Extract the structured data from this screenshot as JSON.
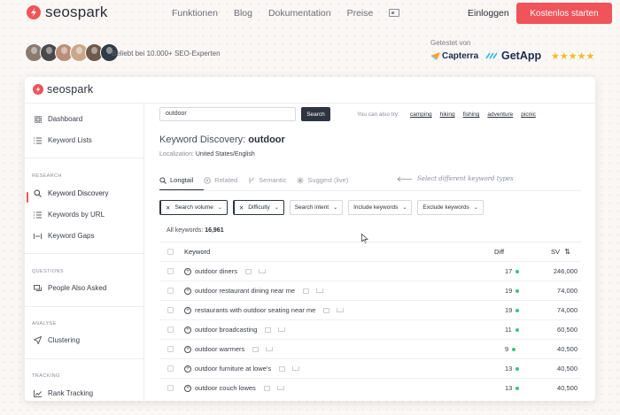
{
  "nav": {
    "brand": "seospark",
    "links": [
      "Funktionen",
      "Blog",
      "Dokumentation",
      "Preise"
    ],
    "login": "Einloggen",
    "cta": "Kostenlos starten"
  },
  "proof": {
    "text": "Beliebt bei 10.000+ SEO-Experten",
    "avatar_colors": [
      "#8b7a6e",
      "#4a4a4a",
      "#b98f7a",
      "#c9a88a",
      "#6e5a4a",
      "#2f3b45"
    ],
    "tested_label": "Getestet von",
    "capterra": "Capterra",
    "getapp": "GetApp",
    "stars": "★★★★★"
  },
  "app": {
    "brand": "seospark",
    "sidebar": {
      "top": [
        {
          "label": "Dashboard",
          "icon": "grid-icon"
        },
        {
          "label": "Keyword Lists",
          "icon": "list-icon"
        }
      ],
      "research_title": "RESEARCH",
      "research": [
        {
          "label": "Keyword Discovery",
          "icon": "search-icon"
        },
        {
          "label": "Keywords by URL",
          "icon": "list-icon"
        },
        {
          "label": "Keyword Gaps",
          "icon": "gap-icon"
        }
      ],
      "questions_title": "QUESTIONS",
      "questions": [
        {
          "label": "People Also Asked",
          "icon": "chat-icon"
        }
      ],
      "analyse_title": "ANALYSE",
      "analyse": [
        {
          "label": "Clustering",
          "icon": "send-icon"
        }
      ],
      "tracking_title": "TRACKING",
      "tracking": [
        {
          "label": "Rank Tracking",
          "icon": "chart-icon"
        }
      ]
    },
    "search": {
      "value": "outdoor",
      "button": "Search",
      "try_label": "You can also try:",
      "suggestions": [
        "camping",
        "hiking",
        "fishing",
        "adventure",
        "picnic"
      ]
    },
    "title_prefix": "Keyword Discovery:",
    "title_term": "outdoor",
    "localization_label": "Localization:",
    "localization_value": "United States/English",
    "tabs": [
      "Longtail",
      "Related",
      "Semantic",
      "Suggest (live)"
    ],
    "hint": "Select different keyword types",
    "filters": {
      "chip1": "Search volume",
      "chip2": "Difficulty",
      "chip3": "Search intent",
      "chip4": "Include keywords",
      "chip5": "Exclude keywords"
    },
    "count_label": "All keywords:",
    "count_value": "16,961",
    "table": {
      "headers": {
        "keyword": "Keyword",
        "diff": "Diff",
        "sv": "SV"
      },
      "rows": [
        {
          "keyword": "outdoor diners",
          "diff": "17",
          "sv": "246,000"
        },
        {
          "keyword": "outdoor restaurant dining near me",
          "diff": "19",
          "sv": "74,000"
        },
        {
          "keyword": "restaurants with outdoor seating near me",
          "diff": "19",
          "sv": "74,000"
        },
        {
          "keyword": "outdoor broadcasting",
          "diff": "11",
          "sv": "60,500"
        },
        {
          "keyword": "outdoor warmers",
          "diff": "9",
          "sv": "40,500"
        },
        {
          "keyword": "outdoor furniture at lowe's",
          "diff": "13",
          "sv": "40,500"
        },
        {
          "keyword": "outdoor couch lowes",
          "diff": "13",
          "sv": "40,500"
        }
      ]
    }
  }
}
